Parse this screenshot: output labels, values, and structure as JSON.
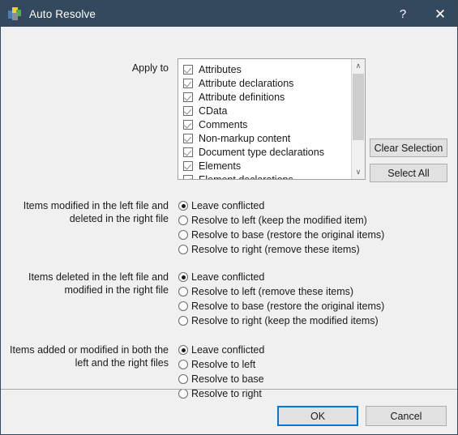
{
  "window": {
    "title": "Auto Resolve",
    "icon": "app-tiles-icon",
    "titlebar_color": "#34495e",
    "help_button": "?",
    "close_button": "✕"
  },
  "apply_to": {
    "label": "Apply to",
    "items": [
      {
        "label": "Attributes",
        "checked": true
      },
      {
        "label": "Attribute declarations",
        "checked": true
      },
      {
        "label": "Attribute definitions",
        "checked": true
      },
      {
        "label": "CData",
        "checked": true
      },
      {
        "label": "Comments",
        "checked": true
      },
      {
        "label": "Non-markup content",
        "checked": true
      },
      {
        "label": "Document type declarations",
        "checked": true
      },
      {
        "label": "Elements",
        "checked": true
      },
      {
        "label": "Element declarations",
        "checked": true
      }
    ],
    "scrollbar": {
      "up_arrow": "∧",
      "down_arrow": "∨"
    },
    "clear_selection_label": "Clear Selection",
    "select_all_label": "Select All"
  },
  "groups": [
    {
      "label": "Items modified in the left file and deleted in the right file",
      "options": [
        {
          "label": "Leave conflicted",
          "selected": true
        },
        {
          "label": "Resolve to left (keep the modified item)",
          "selected": false
        },
        {
          "label": "Resolve to base (restore the original items)",
          "selected": false
        },
        {
          "label": "Resolve to right (remove these items)",
          "selected": false
        }
      ]
    },
    {
      "label": "Items deleted in the left file and modified in the right file",
      "options": [
        {
          "label": "Leave conflicted",
          "selected": true
        },
        {
          "label": "Resolve to left (remove these items)",
          "selected": false
        },
        {
          "label": "Resolve to base (restore the original items)",
          "selected": false
        },
        {
          "label": "Resolve to right (keep the modified items)",
          "selected": false
        }
      ]
    },
    {
      "label": "Items added or modified in both the left and the right files",
      "options": [
        {
          "label": "Leave conflicted",
          "selected": true
        },
        {
          "label": "Resolve to left",
          "selected": false
        },
        {
          "label": "Resolve to base",
          "selected": false
        },
        {
          "label": "Resolve to right",
          "selected": false
        }
      ]
    }
  ],
  "footer": {
    "ok_label": "OK",
    "cancel_label": "Cancel",
    "focus_color": "#0078d7"
  }
}
